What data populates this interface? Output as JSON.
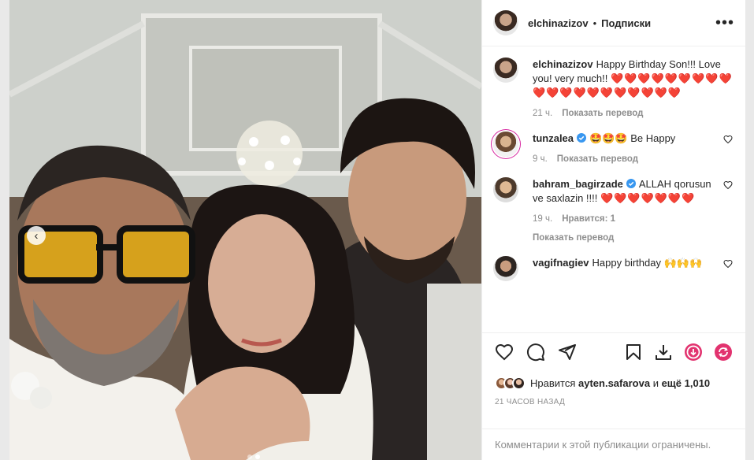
{
  "post": {
    "author": "elchinazizov",
    "separator": "•",
    "follow_label": "Подписки",
    "more_icon": "more-horizontal-icon"
  },
  "caption": {
    "username": "elchinazizov",
    "text": "Happy Birthday Son!!! Love you! very much!!",
    "hearts": "❤️❤️❤️❤️❤️❤️❤️❤️❤️❤️❤️❤️❤️❤️❤️❤️❤️❤️❤️❤️",
    "time": "21 ч.",
    "translate": "Показать перевод"
  },
  "comments": [
    {
      "username": "tunzalea",
      "verified": true,
      "text": "Be Happy",
      "emoji": "🤩🤩🤩",
      "time": "9 ч.",
      "translate": "Показать перевод"
    },
    {
      "username": "bahram_bagirzade",
      "verified": true,
      "text": "ALLAH qorusun ve saxlazin !!!!",
      "hearts": "❤️❤️❤️❤️❤️❤️❤️",
      "time": "19 ч.",
      "likes": "Нравится: 1",
      "translate": "Показать перевод"
    },
    {
      "username": "vagifnagiev",
      "verified": false,
      "text": "Happy birthday",
      "emoji": "🙌🙌🙌"
    }
  ],
  "likes": {
    "prefix": "Нравится",
    "user": "ayten.safarova",
    "and": "и",
    "more": "ещё 1,010"
  },
  "timestamp": "21 ЧАСОВ НАЗАД",
  "restricted": "Комментарии к этой публикации ограничены.",
  "photo": {
    "prev_arrow": "‹"
  },
  "colors": {
    "heart_red": "#e8182c",
    "verified_blue": "#3897f0",
    "story_ring": "#d6249f"
  }
}
